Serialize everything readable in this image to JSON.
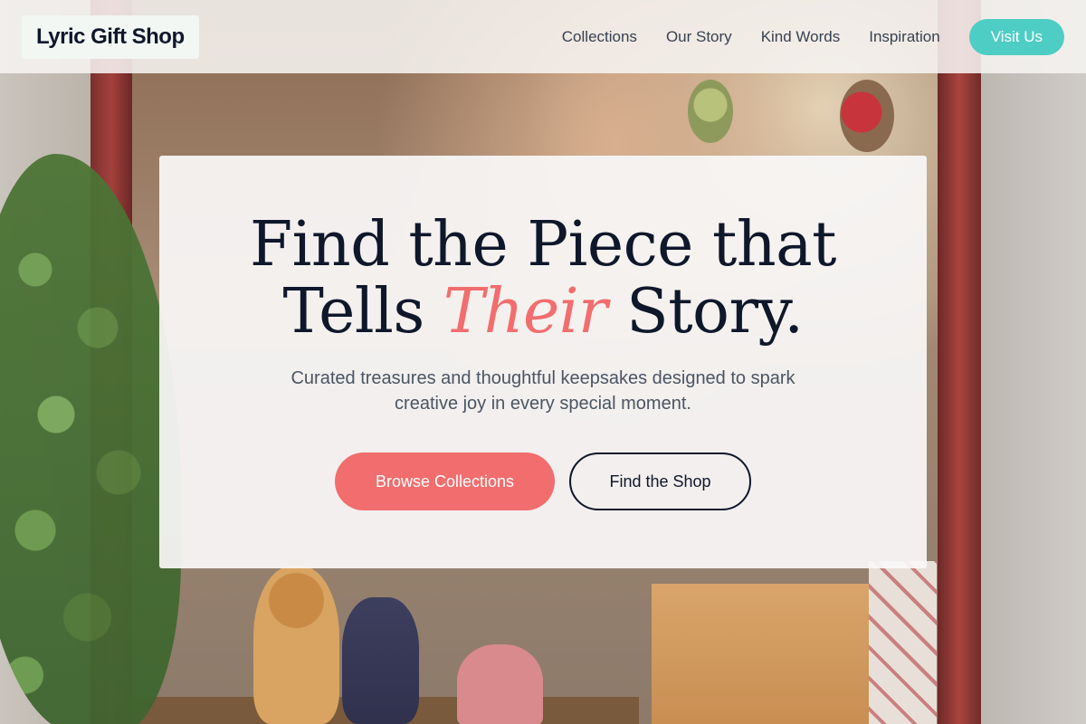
{
  "brand": {
    "name": "Lyric Gift Shop"
  },
  "nav": {
    "items": [
      {
        "label": "Collections"
      },
      {
        "label": "Our Story"
      },
      {
        "label": "Kind Words"
      },
      {
        "label": "Inspiration"
      }
    ],
    "cta_label": "Visit Us"
  },
  "hero": {
    "title_line1": "Find the Piece that",
    "title_line2_before": "Tells ",
    "title_line2_accent": "Their",
    "title_line2_after": " Story.",
    "subtitle": "Curated treasures and thoughtful keepsakes designed to spark creative joy in every special moment.",
    "primary_cta": "Browse Collections",
    "secondary_cta": "Find the Shop"
  },
  "colors": {
    "accent_coral": "#f26d6d",
    "accent_teal": "#4ecdc4",
    "text_dark": "#0f172a",
    "text_muted": "#4b5563"
  }
}
